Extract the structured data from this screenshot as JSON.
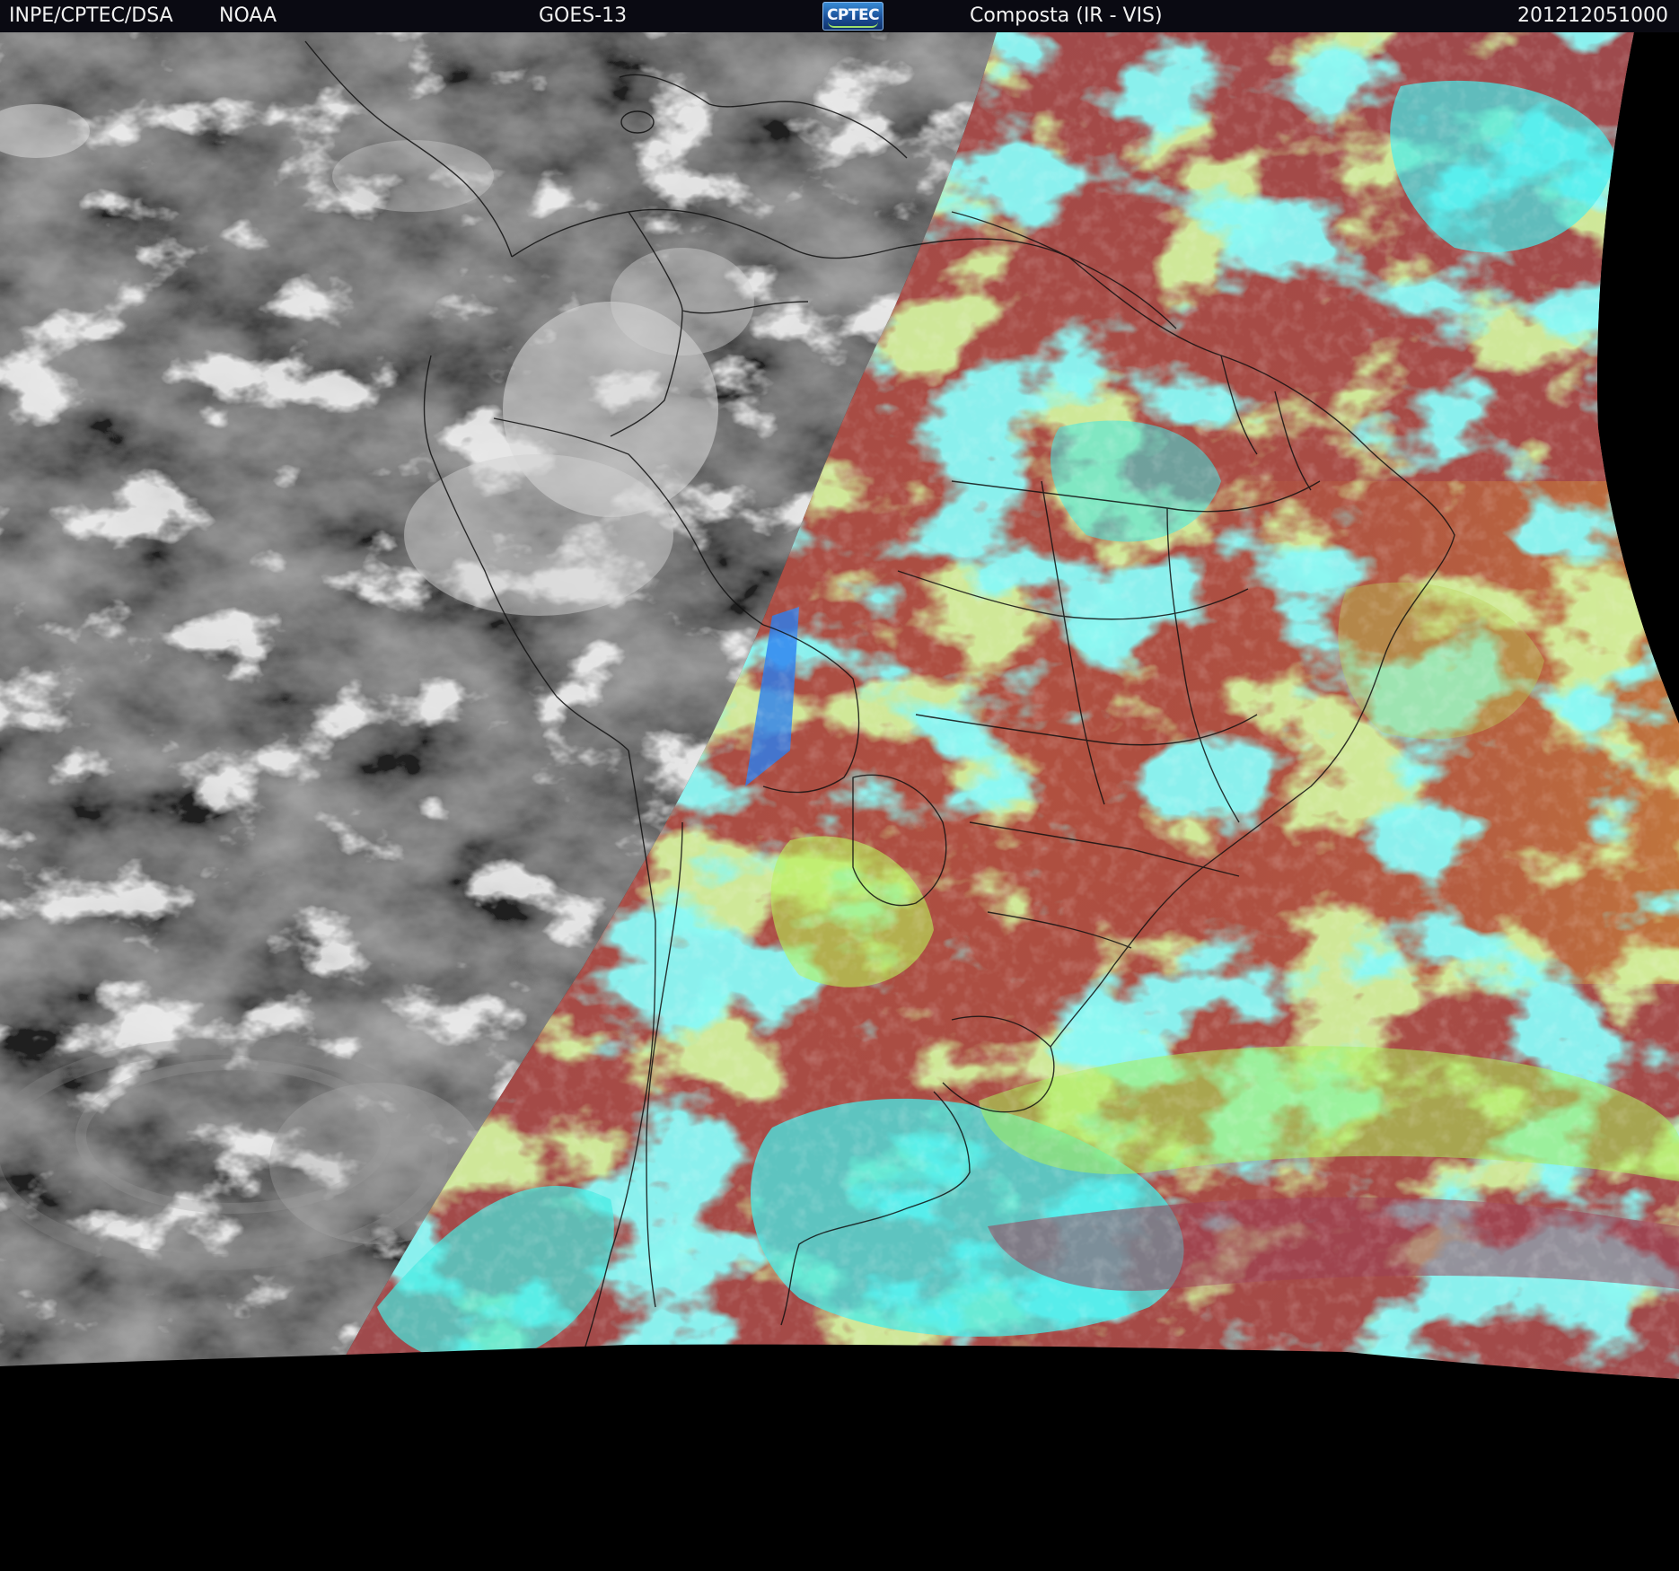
{
  "header": {
    "institution": "INPE/CPTEC/DSA",
    "agency": "NOAA",
    "satellite": "GOES-13",
    "logo_text": "CPTEC",
    "product": "Composta (IR - VIS)",
    "timestamp": "201212051000"
  },
  "colors": {
    "header_bg": "#0a0a12",
    "header_text": "#f2f2f2",
    "space": "#000000",
    "night_ir_base": "#4a4a4a",
    "day_land_red": "#a84b45",
    "day_cloud_cyan": "#3ff2ee",
    "day_cloud_green": "#a8f35a",
    "boundary_lines": "#111111"
  }
}
